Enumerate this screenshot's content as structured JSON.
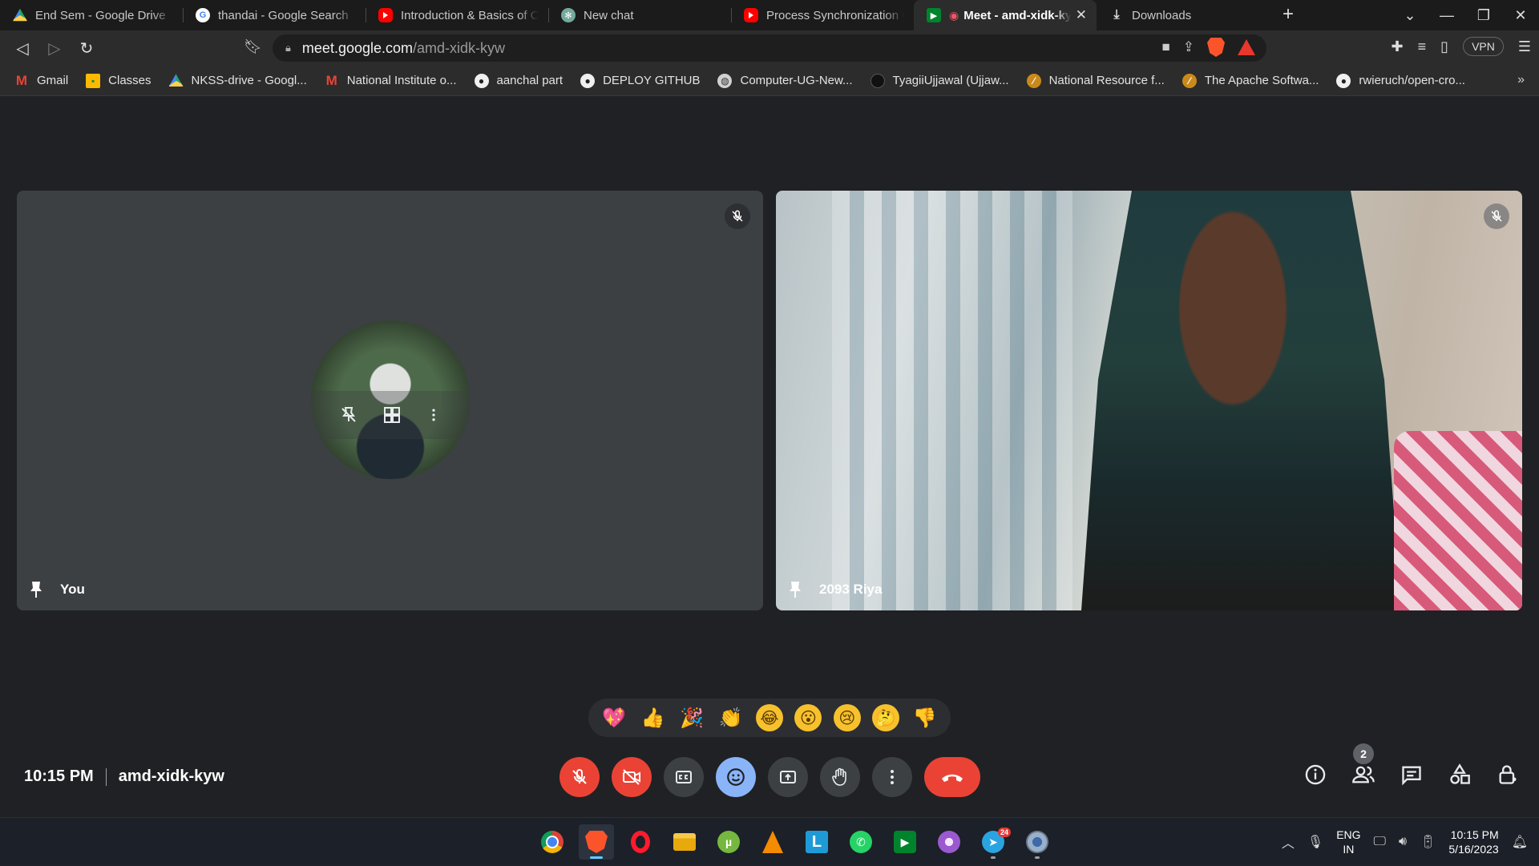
{
  "browser": {
    "tabs": [
      {
        "title": "End Sem - Google Drive",
        "icon": "google-drive-icon",
        "active": false
      },
      {
        "title": "thandai - Google Search",
        "icon": "google-icon",
        "active": false
      },
      {
        "title": "Introduction & Basics of OS",
        "icon": "youtube-icon",
        "active": false
      },
      {
        "title": "New chat",
        "icon": "chatgpt-icon",
        "active": false
      },
      {
        "title": "Process Synchronization GATE",
        "icon": "youtube-icon",
        "active": false
      },
      {
        "title": "Meet - amd-xidk-kyw",
        "icon": "google-meet-icon",
        "active": true
      },
      {
        "title": "Downloads",
        "icon": "download-icon",
        "active": false
      }
    ],
    "url_host": "meet.google.com",
    "url_path": "/amd-xidk-kyw",
    "vpn_label": "VPN",
    "bookmarks": [
      {
        "label": "Gmail",
        "icon": "gmail-icon"
      },
      {
        "label": "Classes",
        "icon": "classroom-icon"
      },
      {
        "label": "NKSS-drive - Googl...",
        "icon": "google-drive-icon"
      },
      {
        "label": "National Institute o...",
        "icon": "gmail-icon"
      },
      {
        "label": "aanchal part",
        "icon": "github-icon"
      },
      {
        "label": "DEPLOY GITHUB",
        "icon": "github-icon"
      },
      {
        "label": "Computer-UG-New...",
        "icon": "globe-icon"
      },
      {
        "label": "TyagiiUjjawal (Ujjaw...",
        "icon": "github-icon"
      },
      {
        "label": "National Resource f...",
        "icon": "apache-icon"
      },
      {
        "label": "The Apache Softwa...",
        "icon": "apache-icon"
      },
      {
        "label": "rwieruch/open-cro...",
        "icon": "github-icon"
      }
    ],
    "bookmarks_more": "»"
  },
  "meet": {
    "participants": [
      {
        "name": "You",
        "camera_on": false,
        "muted": true
      },
      {
        "name": "2093 Riya",
        "camera_on": true,
        "muted": true
      }
    ],
    "reactions": [
      "💖",
      "👍",
      "🎉",
      "👏",
      "😂",
      "😮",
      "😢",
      "🤔",
      "👎"
    ],
    "time": "10:15 PM",
    "meeting_code": "amd-xidk-kyw",
    "participant_count": "2",
    "colors": {
      "danger": "#ea4335",
      "accent": "#8ab4f8",
      "surface": "#202124",
      "tile": "#3c4043"
    }
  },
  "taskbar": {
    "apps": [
      "windows-start-icon",
      "chrome-icon",
      "brave-icon",
      "opera-icon",
      "file-explorer-icon",
      "utorrent-icon",
      "vlc-icon",
      "l-app-icon",
      "whatsapp-icon",
      "google-meet-icon",
      "tor-icon",
      "telegram-icon",
      "settings-icon"
    ],
    "telegram_badge": "24",
    "language": "ENG",
    "region": "IN",
    "clock_time": "10:15 PM",
    "clock_date": "5/16/2023"
  }
}
